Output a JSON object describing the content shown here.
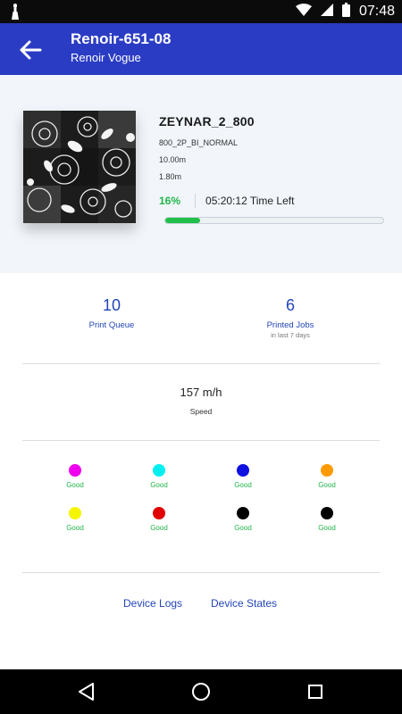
{
  "status_bar": {
    "time": "07:48",
    "icons": [
      "notification-icon",
      "wifi-icon",
      "signal-icon",
      "battery-icon"
    ]
  },
  "app_bar": {
    "title": "Renoir-651-08",
    "subtitle": "Renoir Vogue",
    "back_icon": "arrow-back-icon"
  },
  "job": {
    "name": "ZEYNAR_2_800",
    "profile": "800_2P_BI_NORMAL",
    "length": "10.00m",
    "width": "1.80m",
    "progress_text": "16%",
    "progress_value": 0.16,
    "time_left": "05:20:12 Time Left"
  },
  "stats": {
    "print_queue": {
      "value": "10",
      "label": "Print Queue"
    },
    "printed_jobs": {
      "value": "6",
      "label": "Printed Jobs",
      "sub": "in last 7 days"
    },
    "speed": {
      "value": "157 m/h",
      "label": "Speed"
    }
  },
  "inks": [
    {
      "color": "#ee00ee",
      "status": "Good"
    },
    {
      "color": "#00f0f0",
      "status": "Good"
    },
    {
      "color": "#1010e0",
      "status": "Good"
    },
    {
      "color": "#ff9a00",
      "status": "Good"
    },
    {
      "color": "#f5f500",
      "status": "Good"
    },
    {
      "color": "#e00000",
      "status": "Good"
    },
    {
      "color": "#000000",
      "status": "Good"
    },
    {
      "color": "#000000",
      "status": "Good"
    }
  ],
  "links": {
    "device_logs": "Device Logs",
    "device_states": "Device States"
  },
  "nav": [
    "back-triangle-icon",
    "home-circle-icon",
    "recents-square-icon"
  ],
  "colors": {
    "primary": "#2b3cc4",
    "accent_text": "#2346b8",
    "good": "#22b54a"
  }
}
